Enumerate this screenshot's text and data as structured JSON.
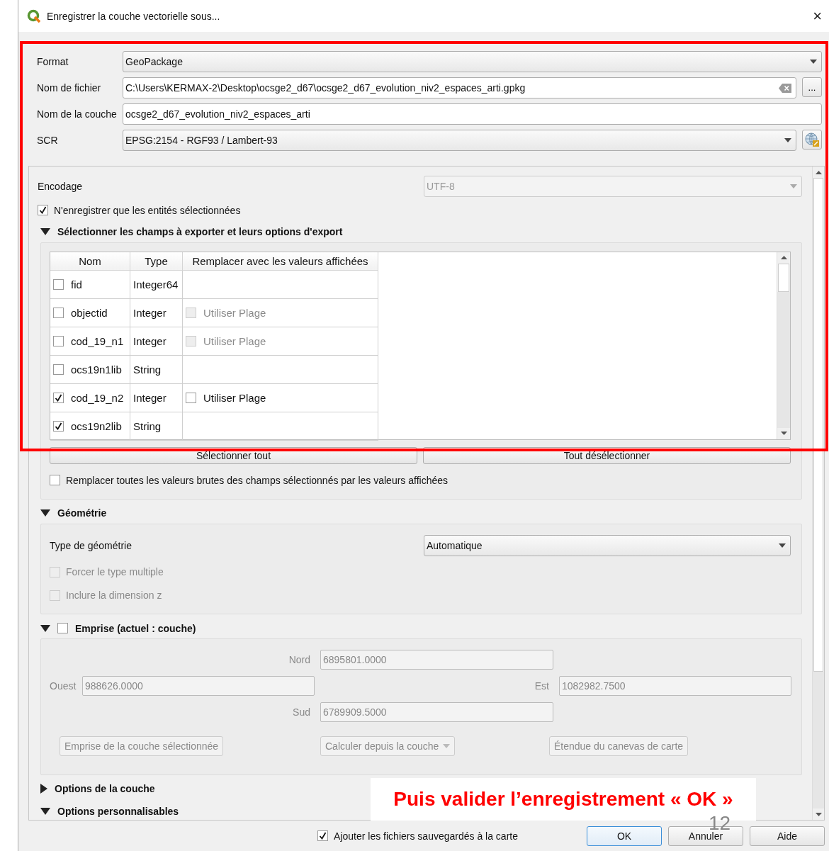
{
  "window": {
    "title": "Enregistrer la couche vectorielle sous...",
    "close": "×"
  },
  "form": [
    {
      "label": "Format",
      "kind": "combo",
      "value": "GeoPackage"
    },
    {
      "label": "Nom de fichier",
      "kind": "file",
      "value": "C:\\Users\\KERMAX-2\\Desktop\\ocsge2_d67\\ocsge2_d67_evolution_niv2_espaces_arti.gpkg",
      "button": "..."
    },
    {
      "label": "Nom de la couche",
      "kind": "text",
      "value": "ocsge2_d67_evolution_niv2_espaces_arti"
    },
    {
      "label": "SCR",
      "kind": "crs",
      "value": "EPSG:2154 - RGF93 / Lambert-93"
    }
  ],
  "encoding": {
    "label": "Encodage",
    "value": "UTF-8",
    "disabled": true
  },
  "selected_only": {
    "label": "N'enregistrer que les entités sélectionnées",
    "checked": true
  },
  "fields_section": {
    "title": "Sélectionner les champs à exporter et leurs options d'export",
    "expanded": true,
    "columns": [
      "Nom",
      "Type",
      "Remplacer avec les valeurs affichées"
    ],
    "rows": [
      {
        "name": "fid",
        "checked": false,
        "type": "Integer64"
      },
      {
        "name": "objectid",
        "checked": false,
        "type": "Integer",
        "replace": {
          "label": "Utiliser Plage",
          "checked": false,
          "disabled": true
        }
      },
      {
        "name": "cod_19_n1",
        "checked": false,
        "type": "Integer",
        "replace": {
          "label": "Utiliser Plage",
          "checked": false,
          "disabled": true
        }
      },
      {
        "name": "ocs19n1lib",
        "checked": false,
        "type": "String"
      },
      {
        "name": "cod_19_n2",
        "checked": true,
        "type": "Integer",
        "replace": {
          "label": "Utiliser Plage",
          "checked": false,
          "disabled": false
        }
      },
      {
        "name": "ocs19n2lib",
        "checked": true,
        "type": "String"
      }
    ],
    "buttons": [
      "Sélectionner tout",
      "Tout désélectionner"
    ],
    "replace_all": {
      "label": "Remplacer toutes les valeurs brutes des champs sélectionnés par les valeurs affichées",
      "checked": false
    }
  },
  "geometry_section": {
    "title": "Géométrie",
    "expanded": true,
    "type_label": "Type de géométrie",
    "type_value": "Automatique",
    "options": [
      {
        "label": "Forcer le type multiple",
        "checked": false,
        "disabled": true
      },
      {
        "label": "Inclure la dimension z",
        "checked": false,
        "disabled": true
      }
    ]
  },
  "extent_section": {
    "title": "Emprise (actuel : couche)",
    "expanded": true,
    "checked": false,
    "north": {
      "label": "Nord",
      "value": "6895801.0000"
    },
    "west": {
      "label": "Ouest",
      "value": "988626.0000"
    },
    "east": {
      "label": "Est",
      "value": "1082982.7500"
    },
    "south": {
      "label": "Sud",
      "value": "6789909.5000"
    },
    "buttons": [
      {
        "label": "Emprise de la couche sélectionnée",
        "kind": "button"
      },
      {
        "label": "Calculer depuis la couche",
        "kind": "menu"
      },
      {
        "label": "Étendue du canevas de carte",
        "kind": "button"
      }
    ]
  },
  "more_sections": [
    {
      "title": "Options de la couche",
      "expanded": false
    },
    {
      "title": "Options personnalisables",
      "expanded": true
    }
  ],
  "footer": {
    "add_to_map": {
      "label": "Ajouter les fichiers sauvegardés à la carte",
      "checked": true
    },
    "buttons": [
      {
        "label": "OK",
        "default": true
      },
      {
        "label": "Annuler",
        "default": false
      },
      {
        "label": "Aide",
        "default": false
      }
    ]
  },
  "annotation": {
    "text": "Puis valider l’enregistrement « OK »"
  },
  "slide_number": "12"
}
